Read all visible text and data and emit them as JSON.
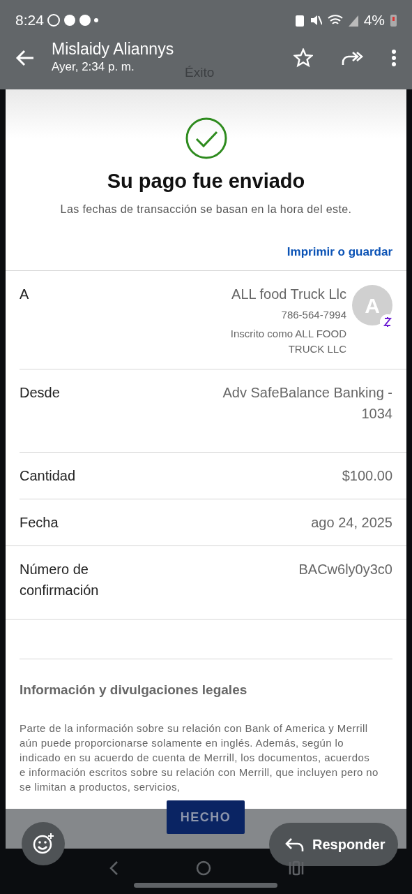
{
  "status_bar": {
    "time": "8:24",
    "battery": "4%"
  },
  "header": {
    "title": "Mislaidy Aliannys",
    "subtitle": "Ayer, 2:34 p. m.",
    "ghost_title": "Éxito"
  },
  "receipt": {
    "heading": "Su pago fue enviado",
    "note": "Las fechas de transacción se basan en la hora del este.",
    "print_link": "Imprimir o guardar",
    "rows": [
      {
        "kind": "payee",
        "label": "A",
        "value": "ALL food Truck Llc",
        "phone": "786-564-7994",
        "enrolled": "Inscrito como ALL FOOD TRUCK LLC",
        "avatar": "A"
      },
      {
        "kind": "plain",
        "label": "Desde",
        "value": "Adv SafeBalance Banking - 1034"
      },
      {
        "kind": "plain",
        "label": "Cantidad",
        "value": "$100.00"
      },
      {
        "kind": "plain",
        "label": "Fecha",
        "value": "ago 24, 2025"
      },
      {
        "kind": "plain",
        "label": "Número de confirmación",
        "value": "BACw6ly0y3c0"
      }
    ],
    "legal_title": "Información y divulgaciones legales",
    "legal_text": "Parte de la información sobre su relación con Bank of America y Merrill aún puede proporcionarse solamente en inglés. Además, según lo indicado en su acuerdo de cuenta de Merrill, los documentos, acuerdos e información escritos sobre su relación con Merrill, que incluyen pero no se limitan a productos, servicios,",
    "done_button": "HECHO"
  },
  "reply_button": "Responder"
}
